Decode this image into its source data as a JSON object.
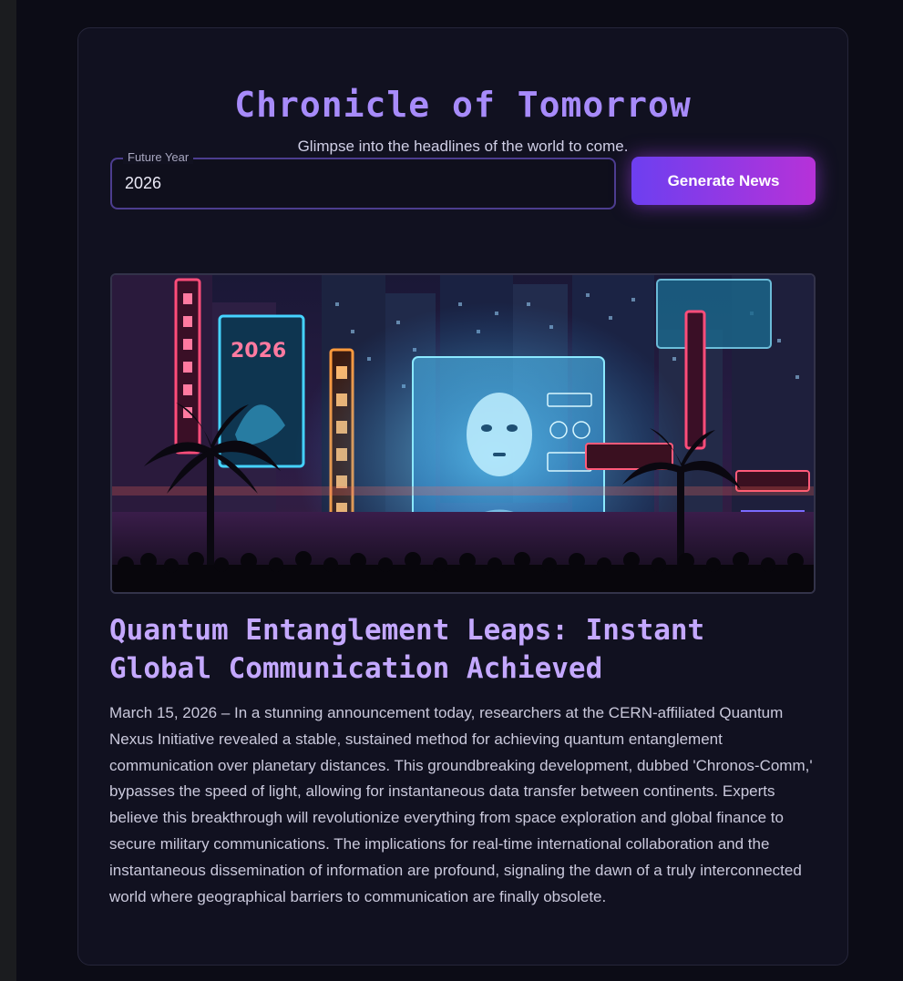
{
  "header": {
    "title": "Chronicle of Tomorrow",
    "subtitle": "Glimpse into the headlines of the world to come."
  },
  "form": {
    "year_label": "Future Year",
    "year_value": "2026",
    "generate_label": "Generate News"
  },
  "article": {
    "image_alt": "Neon-lit futuristic city square with a giant holographic face display",
    "image_sign_text": "2026",
    "headline": "Quantum Entanglement Leaps: Instant Global Communication Achieved",
    "body": "March 15, 2026 – In a stunning announcement today, researchers at the CERN-affiliated Quantum Nexus Initiative revealed a stable, sustained method for achieving quantum entanglement communication over planetary distances. This groundbreaking development, dubbed 'Chronos-Comm,' bypasses the speed of light, allowing for instantaneous data transfer between continents. Experts believe this breakthrough will revolutionize everything from space exploration and global finance to secure military communications. The implications for real-time international collaboration and the instantaneous dissemination of information are profound, signaling the dawn of a truly interconnected world where geographical barriers to communication are finally obsolete."
  },
  "colors": {
    "accent": "#a78bfa",
    "button_gradient_start": "#6d3ff0",
    "button_gradient_end": "#b632d8",
    "headline": "#c4a8ff"
  }
}
